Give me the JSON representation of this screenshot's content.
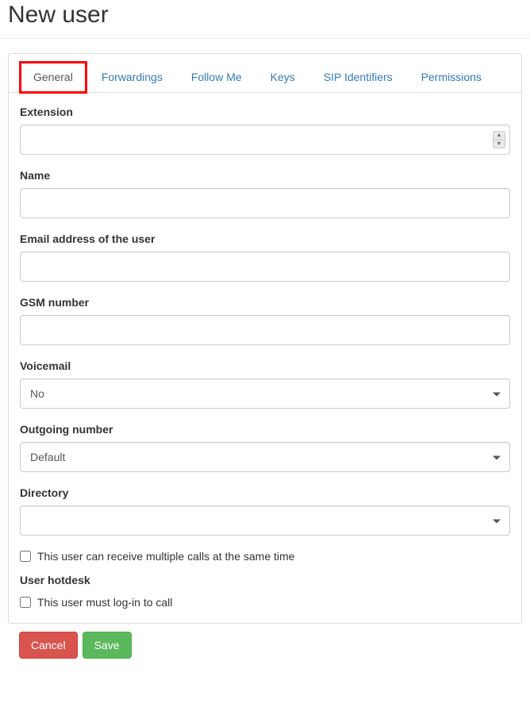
{
  "page": {
    "title": "New user"
  },
  "tabs": {
    "general": "General",
    "forwardings": "Forwardings",
    "follow_me": "Follow Me",
    "keys": "Keys",
    "sip_identifiers": "SIP Identifiers",
    "permissions": "Permissions"
  },
  "form": {
    "extension": {
      "label": "Extension",
      "value": ""
    },
    "name": {
      "label": "Name",
      "value": ""
    },
    "email": {
      "label": "Email address of the user",
      "value": ""
    },
    "gsm": {
      "label": "GSM number",
      "value": ""
    },
    "voicemail": {
      "label": "Voicemail",
      "value": "No"
    },
    "outgoing": {
      "label": "Outgoing number",
      "value": "Default"
    },
    "directory": {
      "label": "Directory",
      "value": ""
    },
    "multi_calls": {
      "label": "This user can receive multiple calls at the same time",
      "checked": false
    },
    "hotdesk": {
      "section_label": "User hotdesk",
      "login_label": "This user must log-in to call",
      "checked": false
    }
  },
  "buttons": {
    "cancel": "Cancel",
    "save": "Save"
  }
}
